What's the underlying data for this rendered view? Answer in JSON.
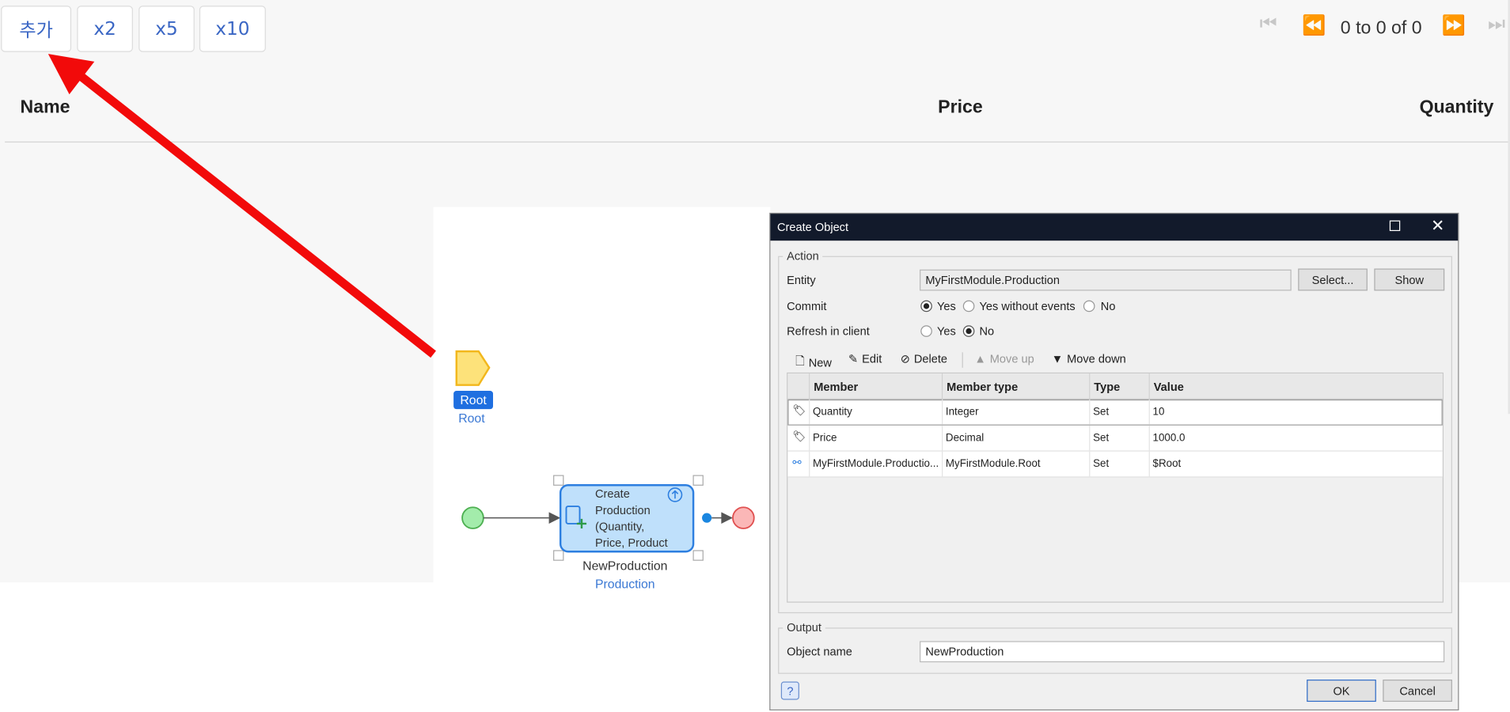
{
  "toolbar": {
    "add_label": "추가",
    "x2_label": "x2",
    "x5_label": "x5",
    "x10_label": "x10"
  },
  "pager": {
    "text": "0 to 0 of 0"
  },
  "grid": {
    "columns": [
      "Name",
      "Price",
      "Quantity"
    ]
  },
  "microflow": {
    "param_name": "Root",
    "param_type": "Root",
    "activity_lines": [
      "Create",
      "Production",
      "(Quantity,",
      "Price, Product"
    ],
    "activity_var": "NewProduction",
    "activity_entity": "Production"
  },
  "dialog": {
    "title": "Create Object",
    "action_group": "Action",
    "entity_label": "Entity",
    "entity_value": "MyFirstModule.Production",
    "select_button": "Select...",
    "show_button": "Show",
    "commit_label": "Commit",
    "commit_options": [
      "Yes",
      "Yes without events",
      "No"
    ],
    "commit_selected": "Yes",
    "refresh_label": "Refresh in client",
    "refresh_options": [
      "Yes",
      "No"
    ],
    "refresh_selected": "No",
    "toolbar": {
      "new": "New",
      "edit": "Edit",
      "delete": "Delete",
      "move_up": "Move up",
      "move_down": "Move down"
    },
    "columns": [
      "Member",
      "Member type",
      "Type",
      "Value"
    ],
    "rows": [
      {
        "member": "Quantity",
        "member_type": "Integer",
        "type": "Set",
        "value": "10",
        "icon": "attribute-tag-icon"
      },
      {
        "member": "Price",
        "member_type": "Decimal",
        "type": "Set",
        "value": "1000.0",
        "icon": "attribute-tag-icon"
      },
      {
        "member": "MyFirstModule.Productio...",
        "member_type": "MyFirstModule.Root",
        "type": "Set",
        "value": "$Root",
        "icon": "association-icon"
      }
    ],
    "output_group": "Output",
    "object_name_label": "Object name",
    "object_name_value": "NewProduction",
    "ok_button": "OK",
    "cancel_button": "Cancel"
  },
  "colors": {
    "accent": "#3a66c4",
    "arrow": "#f20a0a",
    "titlebar": "#121a2b",
    "activity_fill": "#bfe0fb",
    "activity_border": "#2d7fe0"
  }
}
